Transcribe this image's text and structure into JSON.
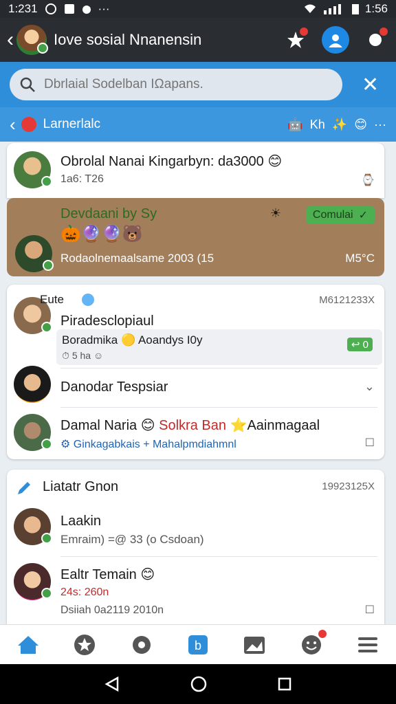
{
  "status": {
    "time_left": "1:231",
    "time_right": "1:56"
  },
  "appbar": {
    "title": "Iove sosial Nnanensin"
  },
  "search": {
    "placeholder": "Dbrlaial Sodelban IΩapans."
  },
  "subbar": {
    "title": "Larnerlalc",
    "right_text": "Kh"
  },
  "chats": [
    {
      "title": "Obrolal Nanai Kingarbyn: da3000",
      "emoji": "😊",
      "sub": "1a6: T26"
    },
    {
      "title": "Devdaani by Sy",
      "emojis": "🎃🔮🔮🐻",
      "pill": "Comulai",
      "sub": "Rodaolnemaalsame 2003 (15",
      "meta": "M5°C"
    }
  ],
  "group_card": {
    "group_label": "Eute",
    "timestamp": "M6121233X",
    "rows": [
      {
        "title": "Piradesclopiaul",
        "msg": "Boradmika",
        "msg2": "Aoandys I0y",
        "msg_sub": "5 ha",
        "count": "0"
      },
      {
        "title": "Danodar Tespsiar"
      },
      {
        "title": "Damal Naria",
        "emoji": "😊",
        "extra": "Solkra Ban",
        "tail": "Aainmagaal",
        "sub": "Ginkagabkais + Mahalpmdiahmnl"
      }
    ]
  },
  "group_card2": {
    "title": "Liatatr Gnon",
    "timestamp": "19923125X",
    "rows": [
      {
        "title": "Laakin",
        "sub": "Emraim) =@ 33 (o Csdoan)"
      },
      {
        "title": "Ealtr Temain",
        "emoji": "😊",
        "sub_red": "24s: 260n",
        "sub": "Dsiiah 0a2119 2010n"
      }
    ]
  },
  "colors": {
    "accent": "#2f8ed9",
    "appbar": "#2a2e33",
    "highlight": "#a27f5a",
    "online": "#43a047"
  },
  "icons": [
    "home-icon",
    "star-icon",
    "settings-icon",
    "b-icon",
    "image-icon",
    "emoji-icon",
    "menu-icon"
  ]
}
